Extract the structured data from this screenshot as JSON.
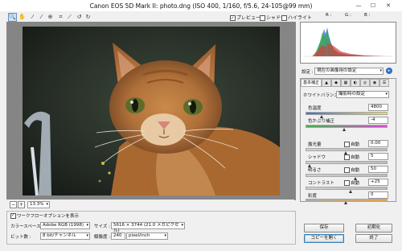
{
  "window": {
    "title": "Canon EOS 5D Mark II:  photo.dng  (ISO 400, 1/160, f/5.6, 24-105@99 mm)",
    "minimize": "—",
    "maximize": "☐",
    "close": "✕"
  },
  "toolbar": {
    "tools": [
      "zoom-icon",
      "hand-icon",
      "white-balance-icon",
      "color-sampler-icon",
      "targeted-adjust-icon",
      "crop-icon",
      "straighten-icon",
      "rotate-ccw-icon",
      "rotate-cw-icon"
    ],
    "preview_label": "プレビュー",
    "shadow_label": "シャドウ",
    "highlight_label": "ハイライト",
    "rgb_r": "R :",
    "rgb_g": "G :",
    "rgb_b": "B :"
  },
  "zoom": {
    "minus": "−",
    "plus": "+",
    "value": "13.3%"
  },
  "options": {
    "workflow_label": "ワークフローオプションを表示",
    "colorspace_label": "カラースペース :",
    "colorspace_value": "Adobe RGB (1998)",
    "size_label": "サイズ :",
    "size_value": "5616 × 3744 (21.0 メガピクセル)",
    "bitdepth_label": "ビット数 :",
    "bitdepth_value": "8 bit/チャンネル",
    "resolution_label": "解像度 :",
    "resolution_value": "240",
    "resolution_unit": "pixel/inch"
  },
  "panel": {
    "settings_label": "設定 :",
    "settings_value": "現在の画像用の設定",
    "section_title": "基本補正",
    "wb_label": "ホワイトバランス :",
    "wb_value": "撮影時の設定",
    "temp_label": "色温度",
    "temp_value": "4800",
    "temp_level": 0.2,
    "tint_label": "色かぶり補正",
    "tint_value": "-4",
    "tint_level": 0.48,
    "exposure_label": "露光量",
    "exposure_auto": "自動",
    "exposure_value": "0.00",
    "exposure_level": 0.5,
    "shadow_label": "シャドウ",
    "shadow_auto": "自動",
    "shadow_value": "5",
    "shadow_level": 0.05,
    "brightness_label": "明るさ",
    "brightness_auto": "自動",
    "brightness_value": "50",
    "brightness_level": 0.62,
    "contrast_label": "コントラスト",
    "contrast_auto": "自動",
    "contrast_value": "+25",
    "contrast_level": 0.56,
    "saturation_label": "彩度",
    "saturation_value": "0",
    "saturation_level": 0.5
  },
  "buttons": {
    "save": "保存",
    "initialize": "初期化",
    "copy": "コピーを開く",
    "done": "終了"
  }
}
